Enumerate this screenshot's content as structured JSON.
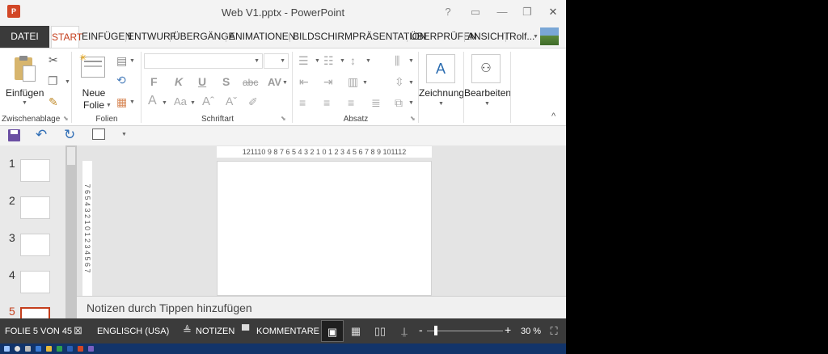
{
  "window": {
    "title": "Web V1.pptx - PowerPoint",
    "app_icon_letter": "P",
    "help_icon": "?",
    "ribbon_display_icon": "▭",
    "minimize_icon": "—",
    "restore_icon": "❐",
    "close_icon": "✕"
  },
  "tabs": {
    "file": "DATEI",
    "items": [
      "START",
      "EINFÜGEN",
      "ENTWURF",
      "ÜBERGÄNGE",
      "ANIMATIONEN",
      "BILDSCHIRMPRÄSENTATION",
      "ÜBERPRÜFEN",
      "ANSICHT"
    ],
    "active": "START",
    "user": "Rolf..."
  },
  "ribbon": {
    "groups": {
      "clipboard": "Zwischenablage",
      "slides": "Folien",
      "font": "Schriftart",
      "paragraph": "Absatz"
    },
    "paste_label": "Einfügen",
    "new_slide_label_1": "Neue",
    "new_slide_label_2": "Folie",
    "drawing_label": "Zeichnung",
    "editing_label": "Bearbeiten",
    "font_buttons": [
      "F",
      "K",
      "U",
      "S",
      "abc",
      "AV"
    ],
    "collapse_icon": "^"
  },
  "quick_access": {
    "save_icon": "save-icon",
    "undo_icon": "undo-icon",
    "redo_icon": "redo-icon",
    "presenter_icon": "presenter-icon"
  },
  "slides_panel": {
    "numbers": [
      "1",
      "2",
      "3",
      "4",
      "5"
    ],
    "selected": "5"
  },
  "rulers": {
    "horizontal": "121110 9 8 7 6 5 4 3 2 1 0 1 2 3 4 5 6 7 8 9 101112",
    "vertical": "7 6 5 4 3 2 1 0 1 2 3 4 5 6 7"
  },
  "notes": {
    "placeholder": "Notizen durch Tippen hinzufügen"
  },
  "status_bar": {
    "slide_info": "FOLIE 5 VON 45",
    "language": "ENGLISCH (USA)",
    "notes_label": "NOTIZEN",
    "comments_label": "KOMMENTARE",
    "zoom_minus": "-",
    "zoom_plus": "+",
    "zoom_percent": "30 %",
    "zoom_level": 30
  },
  "colors": {
    "accent": "#c43e1c",
    "status_bg": "#3b3b3b",
    "taskbar_bg": "#12346a"
  }
}
